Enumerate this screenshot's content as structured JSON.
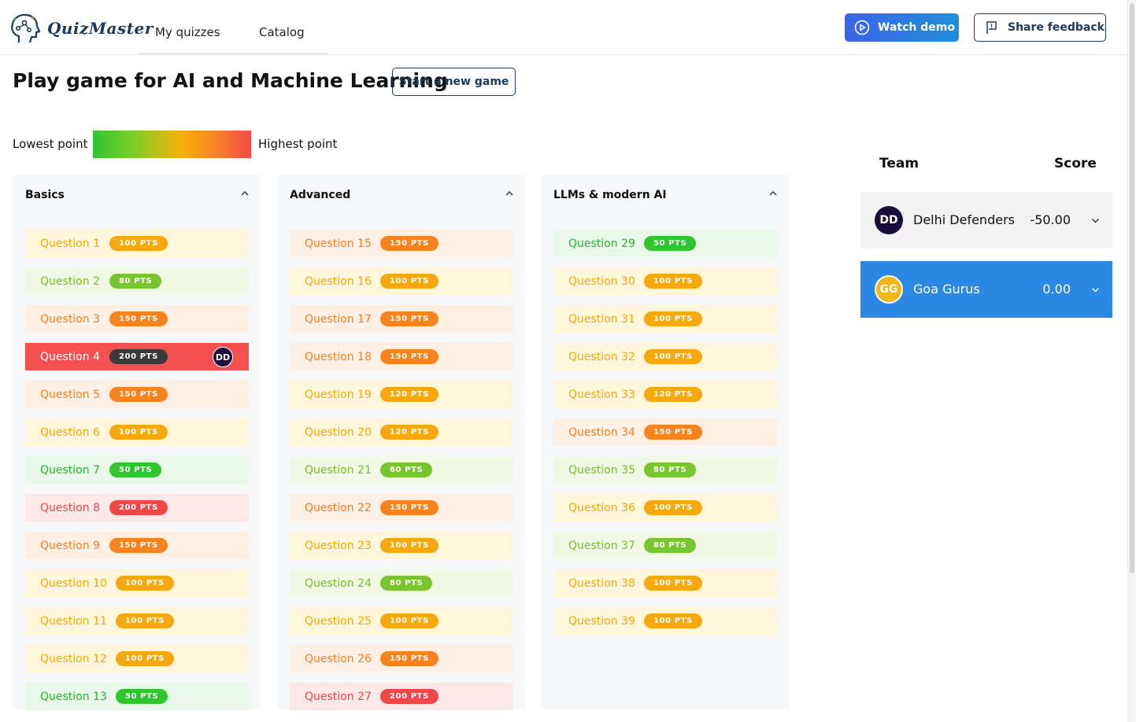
{
  "header": {
    "logo_text": "QuizMaster",
    "nav": [
      "My quizzes",
      "Catalog"
    ],
    "watch_demo": "Watch demo",
    "share_feedback": "Share feedback"
  },
  "page": {
    "title": "Play game for AI and Machine Learning",
    "new_game": "Start a new game"
  },
  "legend": {
    "low": "Lowest point",
    "high": "Highest point",
    "colors": [
      "#2ec52e",
      "#7bcf2a",
      "#f5b00a",
      "#f88a22",
      "#f24a4a"
    ]
  },
  "categories": [
    {
      "name": "Basics",
      "questions": [
        {
          "label": "Question 1",
          "points": "100 PTS",
          "tier": "yellow"
        },
        {
          "label": "Question 2",
          "points": "80 PTS",
          "tier": "lime"
        },
        {
          "label": "Question 3",
          "points": "150 PTS",
          "tier": "orange"
        },
        {
          "label": "Question 4",
          "points": "200 PTS",
          "tier": "active",
          "answered_by": "DD"
        },
        {
          "label": "Question 5",
          "points": "150 PTS",
          "tier": "orange"
        },
        {
          "label": "Question 6",
          "points": "100 PTS",
          "tier": "yellow"
        },
        {
          "label": "Question 7",
          "points": "50 PTS",
          "tier": "green"
        },
        {
          "label": "Question 8",
          "points": "200 PTS",
          "tier": "red"
        },
        {
          "label": "Question 9",
          "points": "150 PTS",
          "tier": "orange"
        },
        {
          "label": "Question 10",
          "points": "100 PTS",
          "tier": "yellow"
        },
        {
          "label": "Question 11",
          "points": "100 PTS",
          "tier": "yellow"
        },
        {
          "label": "Question 12",
          "points": "100 PTS",
          "tier": "yellow"
        },
        {
          "label": "Question 13",
          "points": "50 PTS",
          "tier": "green"
        }
      ]
    },
    {
      "name": "Advanced",
      "questions": [
        {
          "label": "Question 15",
          "points": "150 PTS",
          "tier": "orange"
        },
        {
          "label": "Question 16",
          "points": "100 PTS",
          "tier": "yellow"
        },
        {
          "label": "Question 17",
          "points": "150 PTS",
          "tier": "orange"
        },
        {
          "label": "Question 18",
          "points": "150 PTS",
          "tier": "orange"
        },
        {
          "label": "Question 19",
          "points": "120 PTS",
          "tier": "yellow"
        },
        {
          "label": "Question 20",
          "points": "120 PTS",
          "tier": "yellow"
        },
        {
          "label": "Question 21",
          "points": "60 PTS",
          "tier": "lime"
        },
        {
          "label": "Question 22",
          "points": "150 PTS",
          "tier": "orange"
        },
        {
          "label": "Question 23",
          "points": "100 PTS",
          "tier": "yellow"
        },
        {
          "label": "Question 24",
          "points": "80 PTS",
          "tier": "lime"
        },
        {
          "label": "Question 25",
          "points": "100 PTS",
          "tier": "yellow"
        },
        {
          "label": "Question 26",
          "points": "150 PTS",
          "tier": "orange"
        },
        {
          "label": "Question 27",
          "points": "200 PTS",
          "tier": "red"
        }
      ]
    },
    {
      "name": "LLMs & modern AI",
      "questions": [
        {
          "label": "Question 29",
          "points": "50 PTS",
          "tier": "green"
        },
        {
          "label": "Question 30",
          "points": "100 PTS",
          "tier": "yellow"
        },
        {
          "label": "Question 31",
          "points": "100 PTS",
          "tier": "yellow"
        },
        {
          "label": "Question 32",
          "points": "100 PTS",
          "tier": "yellow"
        },
        {
          "label": "Question 33",
          "points": "120 PTS",
          "tier": "yellow"
        },
        {
          "label": "Question 34",
          "points": "150 PTS",
          "tier": "orange"
        },
        {
          "label": "Question 35",
          "points": "80 PTS",
          "tier": "lime"
        },
        {
          "label": "Question 36",
          "points": "100 PTS",
          "tier": "yellow"
        },
        {
          "label": "Question 37",
          "points": "80 PTS",
          "tier": "lime"
        },
        {
          "label": "Question 38",
          "points": "100 PTS",
          "tier": "yellow"
        },
        {
          "label": "Question 39",
          "points": "100 PTS",
          "tier": "yellow"
        }
      ]
    }
  ],
  "scoreboard": {
    "team_header": "Team",
    "score_header": "Score",
    "teams": [
      {
        "initials": "DD",
        "name": "Delhi Defenders",
        "score": "-50.00"
      },
      {
        "initials": "GG",
        "name": "Goa Gurus",
        "score": "0.00"
      }
    ]
  }
}
